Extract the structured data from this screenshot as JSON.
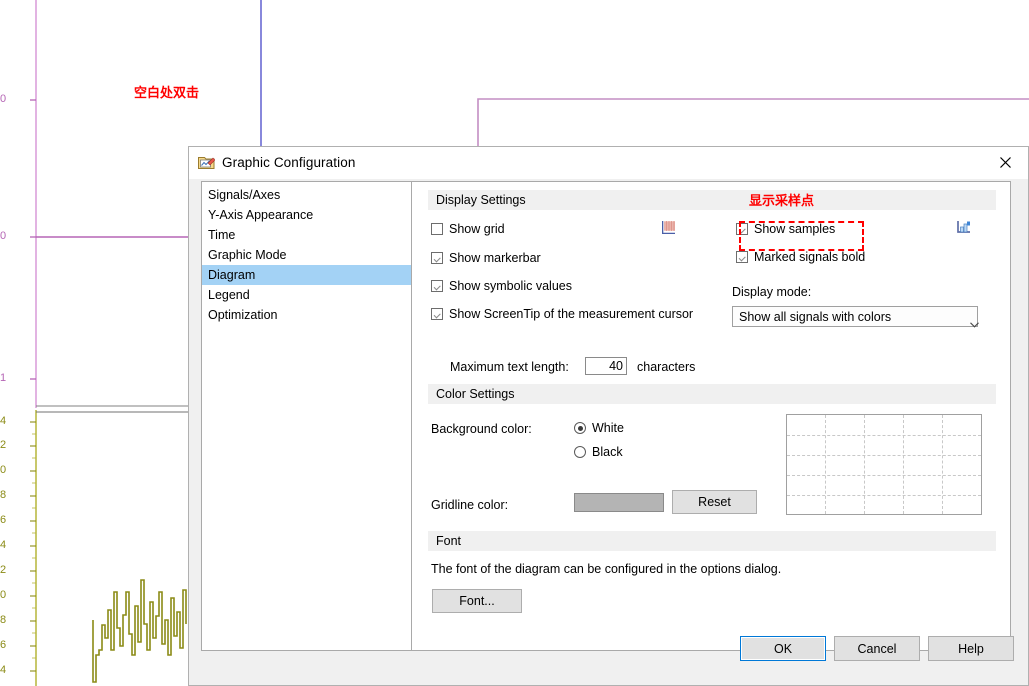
{
  "background": {
    "annotation_blank_dblclick": "空白处双击",
    "trace_color_top": "#b565b5",
    "trace_color_bottom": "#8b8b16",
    "marker_color": "#5555cc",
    "top_axis_ticks": [
      "0",
      "0",
      "1"
    ],
    "bottom_axis_ticks": [
      "4",
      "2",
      "0",
      "8",
      "6",
      "4",
      "2",
      "0",
      "8",
      "6",
      "4"
    ]
  },
  "dialog": {
    "title": "Graphic Configuration",
    "title_icon": "graphic-config-icon",
    "close_icon": "close-icon",
    "nav": {
      "items": [
        {
          "label": "Signals/Axes",
          "selected": false
        },
        {
          "label": "Y-Axis Appearance",
          "selected": false
        },
        {
          "label": "Time",
          "selected": false
        },
        {
          "label": "Graphic Mode",
          "selected": false
        },
        {
          "label": "Diagram",
          "selected": true
        },
        {
          "label": "Legend",
          "selected": false
        },
        {
          "label": "Optimization",
          "selected": false
        }
      ]
    },
    "display_settings": {
      "header": "Display Settings",
      "show_grid": {
        "label": "Show grid",
        "checked": false
      },
      "show_markerbar": {
        "label": "Show markerbar",
        "checked": true
      },
      "show_symbolic_values": {
        "label": "Show symbolic values",
        "checked": true
      },
      "show_screentip": {
        "label": "Show ScreenTip of the measurement cursor",
        "checked": true
      },
      "show_samples": {
        "label": "Show samples",
        "checked": true
      },
      "marked_signals_bold": {
        "label": "Marked signals bold",
        "checked": true
      },
      "grid_icon": "grid-preview-icon",
      "samples_icon": "samples-chart-icon",
      "display_mode_label": "Display mode:",
      "display_mode_value": "Show all signals with colors",
      "display_mode_options": [
        "Show all signals with colors"
      ],
      "max_text_length_label": "Maximum text length:",
      "max_text_length_value": "40",
      "max_text_length_unit": "characters"
    },
    "color_settings": {
      "header": "Color Settings",
      "background_color_label": "Background color:",
      "white_label": "White",
      "white_selected": true,
      "black_label": "Black",
      "black_selected": false,
      "gridline_color_label": "Gridline color:",
      "gridline_swatch_color": "#b4b4b4",
      "reset_label": "Reset"
    },
    "font_settings": {
      "header": "Font",
      "description": "The font of the diagram can be configured in the options dialog.",
      "font_button_label": "Font..."
    },
    "footer": {
      "ok_label": "OK",
      "cancel_label": "Cancel",
      "help_label": "Help"
    }
  },
  "annotations": {
    "show_samples_note": "显示采样点",
    "color": "#ff0000"
  }
}
